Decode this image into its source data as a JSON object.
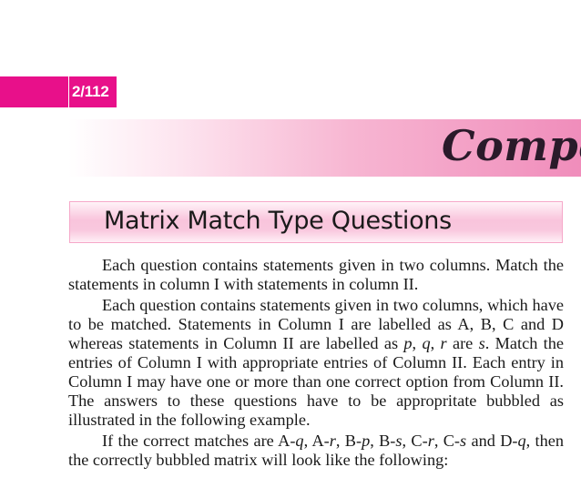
{
  "header": {
    "page_number": "2/112",
    "chapter_title": "Competitio"
  },
  "section": {
    "title": "Matrix Match Type Questions"
  },
  "paragraphs": {
    "p1": "Each question contains statements given in two columns. Match the statements in column I with statements in column II.",
    "p2_part1": "Each question contains statements given in two columns, which have to be matched. Statements in Column I are labelled as A, B, C and D whereas statements in Column II are labelled as ",
    "p2_p": "p",
    "p2_sep1": ", ",
    "p2_q": "q",
    "p2_sep2": ", ",
    "p2_r": "r",
    "p2_are": " are ",
    "p2_s": "s",
    "p2_part2": ". Match the entries of Column I with appropriate entries of Column II. Each entry in Column I may have one or more than one correct option from Column II. The answers to these questions have to be appropritate bubbled as illustrated in the following example.",
    "p3_intro": "If the correct matches are A-",
    "p3_m1": "q",
    "p3_t1": ", A-",
    "p3_m2": "r",
    "p3_t2": ", B-",
    "p3_m3": "p",
    "p3_t3": ", B-",
    "p3_m4": "s",
    "p3_t4": ", C-",
    "p3_m5": "r",
    "p3_t5": ", C-",
    "p3_m6": "s",
    "p3_t6": " and D-",
    "p3_m7": "q",
    "p3_end": ", then the correctly bubbled matrix will look like the following:"
  },
  "colors": {
    "accent": "#e8108a",
    "banner_end": "#f08dbb",
    "section_fill": "#f9c4dc"
  }
}
